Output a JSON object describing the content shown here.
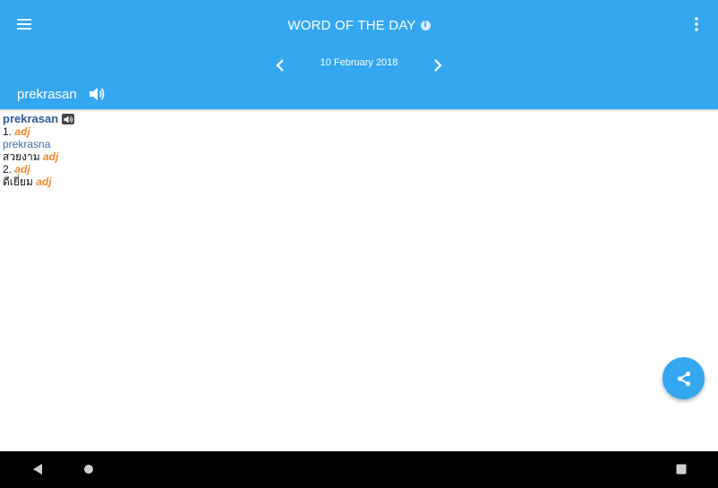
{
  "appbar": {
    "title": "WORD OF THE DAY",
    "info_icon": "info-icon",
    "menu_icon": "hamburger-menu-icon",
    "more_icon": "more-vertical-icon",
    "date": "10 February 2018",
    "prev_icon": "chevron-left-icon",
    "next_icon": "chevron-right-icon",
    "word": "prekrasan",
    "speaker_icon": "speaker-icon",
    "color": "#34a7f0"
  },
  "entry": {
    "headword": "prekrasan",
    "senses": [
      {
        "number": "1.",
        "pos": "adj",
        "lemma": "prekrasna",
        "translation": "สวยงาม",
        "translation_pos": "adj"
      },
      {
        "number": "2.",
        "pos": "adj",
        "translation": "ดีเยี่ยม",
        "translation_pos": "adj"
      }
    ],
    "colors": {
      "headword": "#2d5d9a",
      "pos": "#f0892c",
      "lemma": "#3c6fa6"
    }
  },
  "fab": {
    "icon": "share-icon"
  },
  "navbar": {
    "back_icon": "back-triangle-icon",
    "home_icon": "home-circle-icon",
    "recents_icon": "recents-square-icon"
  }
}
